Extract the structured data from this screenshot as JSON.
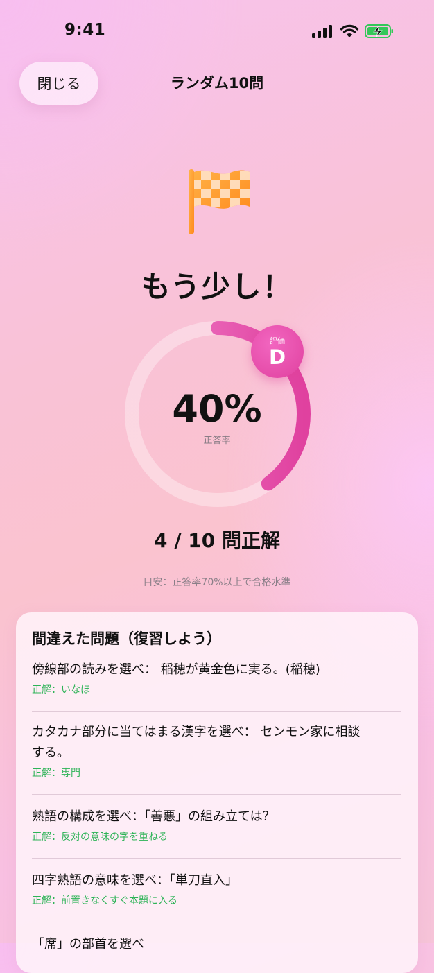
{
  "status": {
    "time": "9:41",
    "icons": [
      "signal-icon",
      "wifi-icon",
      "battery-charging-icon"
    ],
    "battery_color": "#34c759"
  },
  "nav": {
    "close_label": "閉じる",
    "title": "ランダム10問"
  },
  "result": {
    "icon": "checkered-flag-icon",
    "headline": "もう少し！",
    "percent_text": "40%",
    "percent_label": "正答率",
    "progress": 0.4,
    "grade_label": "評価",
    "grade": "D",
    "score_text": "4 / 10 問正解",
    "hint": "目安：正答率70%以上で合格水準"
  },
  "colors": {
    "accent": "#e0419f",
    "correct": "#2db357"
  },
  "review": {
    "title": "間違えた問題（復習しよう）",
    "items": [
      {
        "question": "傍線部の読みを選べ： 稲穂が黄金色に実る。(稲穂)",
        "answer": "正解：いなほ"
      },
      {
        "question": "カタカナ部分に当てはまる漢字を選べ： センモン家に相談する。",
        "answer": "正解：専門"
      },
      {
        "question": "熟語の構成を選べ：「善悪」の組み立ては？",
        "answer": "正解：反対の意味の字を重ねる"
      },
      {
        "question": "四字熟語の意味を選べ：「単刀直入」",
        "answer": "正解：前置きなくすぐ本題に入る"
      },
      {
        "question": "「席」の部首を選べ",
        "answer": ""
      }
    ]
  }
}
